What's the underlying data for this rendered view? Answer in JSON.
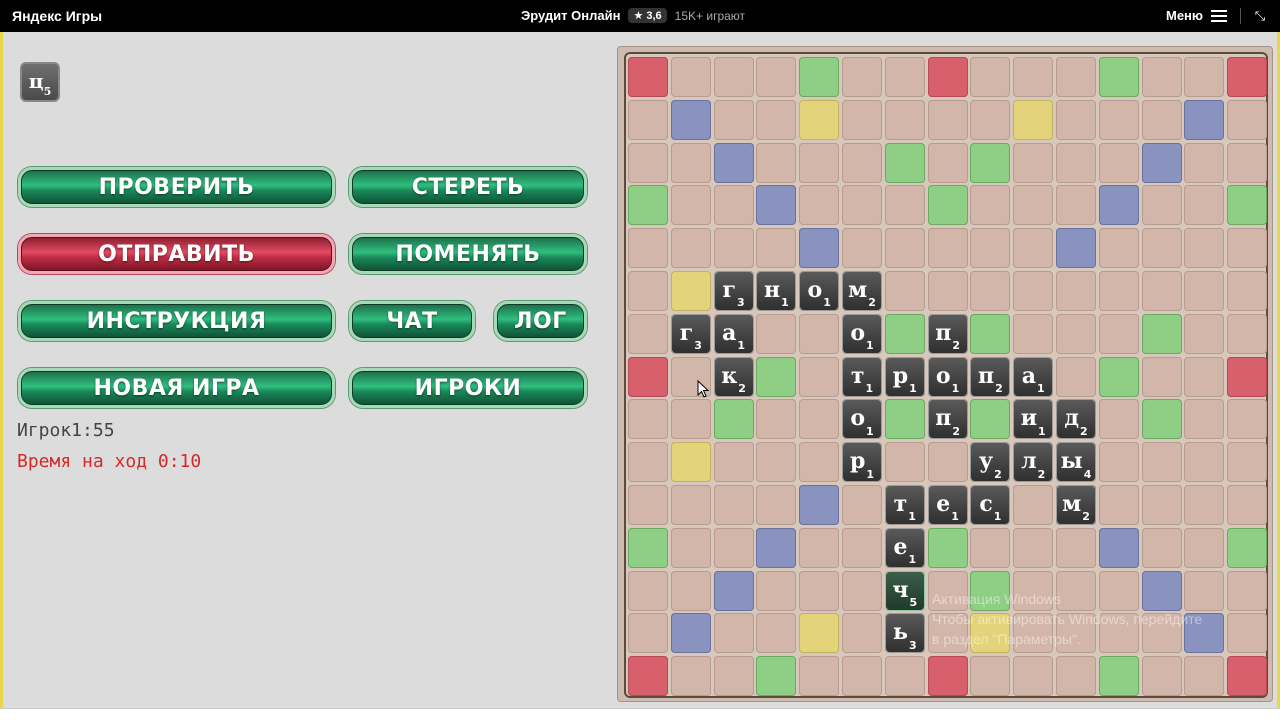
{
  "topbar": {
    "brand": "Яндекс Игры",
    "game_title": "Эрудит Онлайн",
    "rating": "★ 3,6",
    "players_online": "15K+ играют",
    "menu_label": "Меню"
  },
  "rack": {
    "tile": {
      "letter": "ц",
      "points": "5"
    }
  },
  "buttons": {
    "check": "ПРОВЕРИТЬ",
    "erase": "СТЕРЕТЬ",
    "send": "ОТПРАВИТЬ",
    "exchange": "ПОМЕНЯТЬ",
    "instructions": "ИНСТРУКЦИЯ",
    "chat": "ЧАТ",
    "log": "ЛОГ",
    "new_game": "НОВАЯ ИГРА",
    "players": "ИГРОКИ"
  },
  "status": {
    "score": "Игрок1:55",
    "turn_time": "Время на ход 0:10"
  },
  "watermark": {
    "line1": "Активация Windows",
    "line2": "Чтобы активировать Windows, перейдите",
    "line3": "в раздел \"Параметры\"."
  },
  "colors": {
    "bonus_red": "#d8606d",
    "bonus_green": "#8fcf85",
    "bonus_blue": "#8a92bf",
    "bonus_yellow": "#e3d37a",
    "cell": "#d3b6aa",
    "button_green": "#2fbf7f",
    "button_red": "#e24a62"
  },
  "board": {
    "size": 15,
    "bonus_rows": [
      "R...G..R...G..R",
      ".B..Y....Y...B.",
      "..B...G.G...B..",
      "G..B...G...B..G",
      "....B.....B....",
      ".Y.............",
      "......G.G...G..",
      "R..G.......G..R",
      "..G...G.G...G..",
      ".Y.............",
      "....B.....B....",
      "G..B...G...B..G",
      "..B.....G...B..",
      ".B..Y...Y....B.",
      "R..G...R...G..R"
    ],
    "tiles": [
      {
        "row": 5,
        "col": 2,
        "letter": "г",
        "points": "3"
      },
      {
        "row": 5,
        "col": 3,
        "letter": "н",
        "points": "1"
      },
      {
        "row": 5,
        "col": 4,
        "letter": "о",
        "points": "1"
      },
      {
        "row": 5,
        "col": 5,
        "letter": "м",
        "points": "2"
      },
      {
        "row": 6,
        "col": 1,
        "letter": "г",
        "points": "3"
      },
      {
        "row": 6,
        "col": 2,
        "letter": "а",
        "points": "1"
      },
      {
        "row": 6,
        "col": 5,
        "letter": "о",
        "points": "1"
      },
      {
        "row": 6,
        "col": 7,
        "letter": "п",
        "points": "2"
      },
      {
        "row": 7,
        "col": 2,
        "letter": "к",
        "points": "2"
      },
      {
        "row": 7,
        "col": 5,
        "letter": "т",
        "points": "1"
      },
      {
        "row": 7,
        "col": 6,
        "letter": "р",
        "points": "1"
      },
      {
        "row": 7,
        "col": 7,
        "letter": "о",
        "points": "1"
      },
      {
        "row": 7,
        "col": 8,
        "letter": "п",
        "points": "2"
      },
      {
        "row": 7,
        "col": 9,
        "letter": "а",
        "points": "1"
      },
      {
        "row": 8,
        "col": 5,
        "letter": "о",
        "points": "1"
      },
      {
        "row": 8,
        "col": 7,
        "letter": "п",
        "points": "2"
      },
      {
        "row": 8,
        "col": 9,
        "letter": "и",
        "points": "1"
      },
      {
        "row": 8,
        "col": 10,
        "letter": "д",
        "points": "2"
      },
      {
        "row": 9,
        "col": 5,
        "letter": "р",
        "points": "1"
      },
      {
        "row": 9,
        "col": 8,
        "letter": "у",
        "points": "2"
      },
      {
        "row": 9,
        "col": 9,
        "letter": "л",
        "points": "2"
      },
      {
        "row": 9,
        "col": 10,
        "letter": "ы",
        "points": "4"
      },
      {
        "row": 10,
        "col": 6,
        "letter": "т",
        "points": "1"
      },
      {
        "row": 10,
        "col": 7,
        "letter": "е",
        "points": "1"
      },
      {
        "row": 10,
        "col": 8,
        "letter": "с",
        "points": "1"
      },
      {
        "row": 10,
        "col": 10,
        "letter": "м",
        "points": "2"
      },
      {
        "row": 11,
        "col": 6,
        "letter": "е",
        "points": "1"
      },
      {
        "row": 12,
        "col": 6,
        "letter": "ч",
        "points": "5",
        "new": true
      },
      {
        "row": 13,
        "col": 6,
        "letter": "ь",
        "points": "3"
      }
    ]
  }
}
